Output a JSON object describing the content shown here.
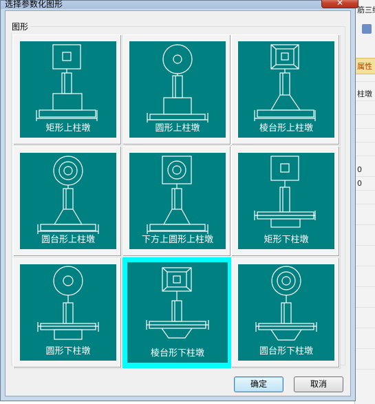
{
  "background_app": {
    "texts": [
      "筋三维",
      "属性",
      "柱墩",
      "0",
      "0"
    ]
  },
  "dialog": {
    "title": "选择参数化图形",
    "close_glyph": "✕",
    "group_label": "图形",
    "shapes": [
      {
        "label": "矩形上柱墩"
      },
      {
        "label": "圆形上柱墩"
      },
      {
        "label": "棱台形上柱墩"
      },
      {
        "label": "圆台形上柱墩"
      },
      {
        "label": "下方上圆形上柱墩"
      },
      {
        "label": "矩形下柱墩"
      },
      {
        "label": "圆形下柱墩"
      },
      {
        "label": "棱台形下柱墩",
        "selected": true
      },
      {
        "label": "圆台形下柱墩"
      }
    ],
    "ok_label": "确定",
    "cancel_label": "取消"
  },
  "colors": {
    "tile_background": "#008080",
    "selection_highlight": "#00ffff",
    "drawing_lines": "#ffffff"
  }
}
